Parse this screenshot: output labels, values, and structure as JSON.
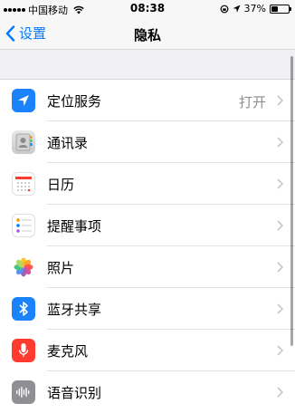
{
  "status_bar": {
    "carrier": "中国移动",
    "time": "08:38",
    "battery": "37%",
    "battery_level": 0.37
  },
  "nav": {
    "back_label": "设置",
    "title": "隐私"
  },
  "rows": [
    {
      "label": "定位服务",
      "value": "打开",
      "icon": "location-arrow-icon"
    },
    {
      "label": "通讯录",
      "icon": "contacts-icon"
    },
    {
      "label": "日历",
      "icon": "calendar-icon"
    },
    {
      "label": "提醒事项",
      "icon": "reminders-icon"
    },
    {
      "label": "照片",
      "icon": "photos-icon"
    },
    {
      "label": "蓝牙共享",
      "icon": "bluetooth-icon"
    },
    {
      "label": "麦克风",
      "icon": "microphone-icon"
    },
    {
      "label": "语音识别",
      "icon": "speech-recognition-icon"
    }
  ],
  "colors": {
    "accent": "#007aff",
    "location_icon_bg": "#1a82fb",
    "bluetooth_icon_bg": "#1a82fb",
    "microphone_icon_bg": "#ff3b30",
    "speech_icon_bg": "#8e8e93"
  }
}
